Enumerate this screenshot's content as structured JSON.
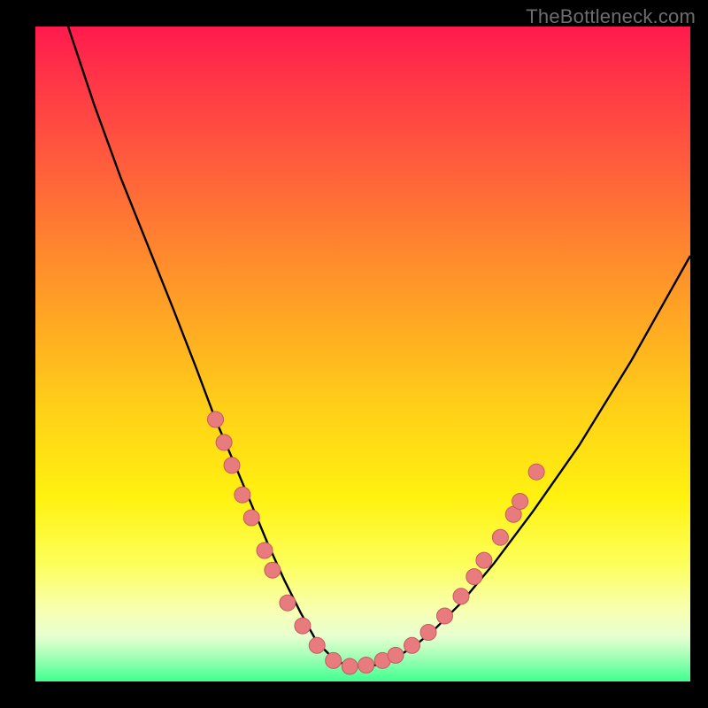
{
  "watermark": "TheBottleneck.com",
  "colors": {
    "frame": "#000000",
    "curve": "#000000",
    "marker_fill": "#e77b7e",
    "marker_stroke": "#c85a5e",
    "gradient_top": "#ff1a4d",
    "gradient_bottom": "#40ff90"
  },
  "chart_data": {
    "type": "line",
    "title": "",
    "xlabel": "",
    "ylabel": "",
    "xlim": [
      0,
      100
    ],
    "ylim": [
      0,
      100
    ],
    "grid": false,
    "legend": false,
    "notes": "V-shaped bottleneck curve over rainbow heat gradient. x and y are normalized 0–100 within the plot area; y=0 is bottom, y=100 is top. Left branch enters from top at x≈5 and descends to a flat minimum (y≈2) around x≈40–48; right branch rises to y≈65 at x=100. Salmon circular markers cluster on both branches in the y≈4–30 band.",
    "series": [
      {
        "name": "bottleneck-curve",
        "x": [
          5,
          9,
          13,
          17,
          21,
          24.5,
          27.5,
          30.5,
          33,
          35.5,
          38,
          40.5,
          43,
          46,
          49,
          52,
          55,
          58,
          61,
          65,
          70,
          76,
          83,
          91,
          100
        ],
        "y": [
          100,
          88,
          77,
          67,
          57,
          48,
          40,
          33,
          27,
          21,
          15.5,
          10.5,
          6,
          3,
          2.2,
          2.5,
          3.6,
          5.5,
          8,
          12,
          18,
          26,
          36,
          49,
          65
        ]
      }
    ],
    "markers": [
      {
        "x": 27.5,
        "y": 40
      },
      {
        "x": 28.8,
        "y": 36.5
      },
      {
        "x": 30.0,
        "y": 33
      },
      {
        "x": 31.6,
        "y": 28.5
      },
      {
        "x": 33.0,
        "y": 25
      },
      {
        "x": 35.0,
        "y": 20
      },
      {
        "x": 36.2,
        "y": 17
      },
      {
        "x": 38.5,
        "y": 12
      },
      {
        "x": 40.8,
        "y": 8.5
      },
      {
        "x": 43.0,
        "y": 5.5
      },
      {
        "x": 45.5,
        "y": 3.2
      },
      {
        "x": 48.0,
        "y": 2.3
      },
      {
        "x": 50.5,
        "y": 2.5
      },
      {
        "x": 53.0,
        "y": 3.2
      },
      {
        "x": 55.0,
        "y": 4.0
      },
      {
        "x": 57.5,
        "y": 5.5
      },
      {
        "x": 60.0,
        "y": 7.5
      },
      {
        "x": 62.5,
        "y": 10
      },
      {
        "x": 65.0,
        "y": 13
      },
      {
        "x": 67.0,
        "y": 16
      },
      {
        "x": 68.5,
        "y": 18.5
      },
      {
        "x": 71.0,
        "y": 22
      },
      {
        "x": 73.0,
        "y": 25.5
      },
      {
        "x": 74.0,
        "y": 27.5
      },
      {
        "x": 76.5,
        "y": 32
      }
    ],
    "marker_radius": 9
  }
}
